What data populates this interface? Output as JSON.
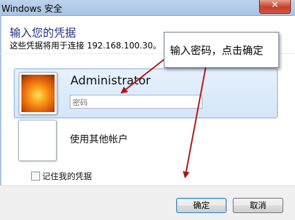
{
  "window": {
    "title": "Windows 安全",
    "close_symbol": "✕"
  },
  "header": {
    "title": "输入您的凭据",
    "subtitle": "这些凭据将用于连接 192.168.100.30。"
  },
  "credential": {
    "account_name": "Administrator",
    "password_placeholder": "密码",
    "password_value": ""
  },
  "other_account": {
    "label": "使用其他帐户"
  },
  "remember": {
    "label": "记住我的凭据",
    "checked": false
  },
  "buttons": {
    "ok_label": "确定",
    "cancel_label": "取消"
  },
  "annotation": {
    "text": "输入密码，点击确定",
    "arrow_color": "#b01515"
  }
}
